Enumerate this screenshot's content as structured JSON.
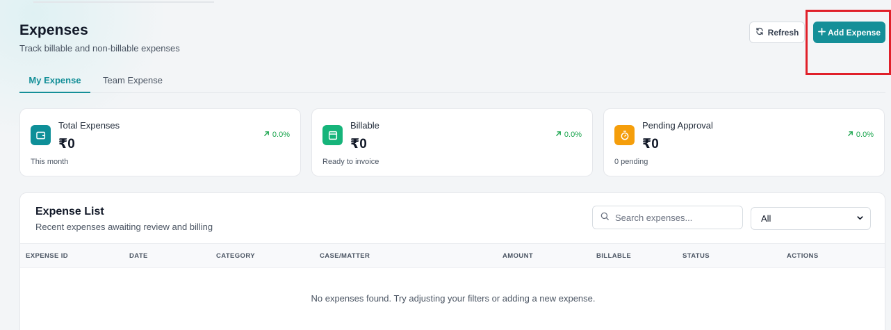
{
  "header": {
    "title": "Expenses",
    "subtitle": "Track billable and non-billable expenses"
  },
  "actions": {
    "refresh_label": "Refresh",
    "add_label": "Add Expense"
  },
  "tabs": [
    {
      "label": "My Expense",
      "active": true
    },
    {
      "label": "Team Expense",
      "active": false
    }
  ],
  "stats": [
    {
      "title": "Total Expenses",
      "value": "₹0",
      "trend": "0.0%",
      "footnote": "This month",
      "icon": "wallet-icon",
      "color": "#0e8f98"
    },
    {
      "title": "Billable",
      "value": "₹0",
      "trend": "0.0%",
      "footnote": "Ready to invoice",
      "icon": "invoice-icon",
      "color": "#16b47a"
    },
    {
      "title": "Pending Approval",
      "value": "₹0",
      "trend": "0.0%",
      "footnote": "0 pending",
      "icon": "timer-icon",
      "color": "#f59e0b"
    }
  ],
  "expense_list": {
    "title": "Expense List",
    "subtitle": "Recent expenses awaiting review and billing",
    "search_placeholder": "Search expenses...",
    "filter_value": "All",
    "columns": [
      "EXPENSE ID",
      "DATE",
      "CATEGORY",
      "CASE/MATTER",
      "AMOUNT",
      "BILLABLE",
      "STATUS",
      "ACTIONS"
    ],
    "empty_message": "No expenses found. Try adjusting your filters or adding a new expense."
  },
  "colors": {
    "accent": "#148f98",
    "trend_up": "#16a34a",
    "highlight": "#e0202a"
  }
}
